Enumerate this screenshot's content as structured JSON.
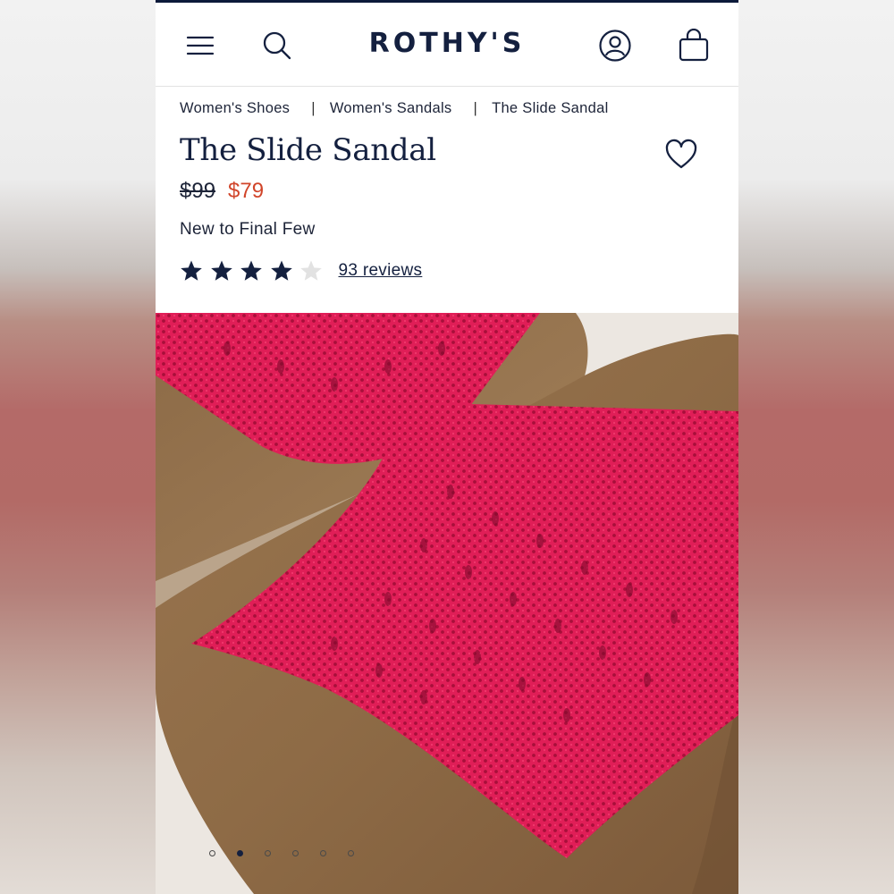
{
  "header": {
    "brand": "ROTHY'S",
    "icons": [
      "menu-icon",
      "search-icon",
      "account-icon",
      "bag-icon"
    ]
  },
  "breadcrumb": {
    "items": [
      "Women's Shoes",
      "Women's Sandals",
      "The Slide Sandal"
    ],
    "separator": "|"
  },
  "product": {
    "title": "The Slide Sandal",
    "original_price": "$99",
    "sale_price": "$79",
    "tag": "New to Final Few",
    "rating": {
      "value": 4,
      "max": 5,
      "reviews_label": "93 reviews"
    }
  },
  "gallery": {
    "dot_count": 6,
    "active_index": 1
  },
  "colors": {
    "navy": "#14203f",
    "sale_red": "#d1452a",
    "knit_pink": "#e0245a",
    "footbed_brown": "#8e6a45"
  }
}
